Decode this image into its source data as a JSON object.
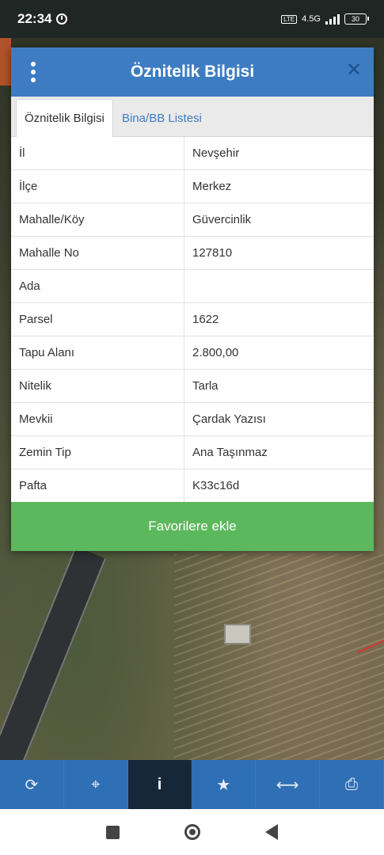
{
  "status": {
    "time": "22:34",
    "network": "4.5G",
    "volte": "LTE",
    "battery": "30"
  },
  "dialog": {
    "title": "Öznitelik Bilgisi",
    "tabs": [
      {
        "label": "Öznitelik Bilgisi",
        "active": true
      },
      {
        "label": "Bina/BB Listesi",
        "active": false
      }
    ],
    "rows": [
      {
        "key": "İl",
        "value": "Nevşehir"
      },
      {
        "key": "İlçe",
        "value": "Merkez"
      },
      {
        "key": "Mahalle/Köy",
        "value": "Güvercinlik"
      },
      {
        "key": "Mahalle No",
        "value": "127810"
      },
      {
        "key": "Ada",
        "value": ""
      },
      {
        "key": "Parsel",
        "value": "1622"
      },
      {
        "key": "Tapu Alanı",
        "value": "2.800,00"
      },
      {
        "key": "Nitelik",
        "value": "Tarla"
      },
      {
        "key": "Mevkii",
        "value": "Çardak Yazısı"
      },
      {
        "key": "Zemin Tip",
        "value": "Ana Taşınmaz"
      },
      {
        "key": "Pafta",
        "value": "K33c16d"
      }
    ],
    "favorite_button": "Favorilere ekle"
  },
  "toolbar": {
    "items": [
      {
        "icon": "refresh-icon",
        "glyph": "⟳"
      },
      {
        "icon": "locate-icon",
        "glyph": "⌖"
      },
      {
        "icon": "info-icon",
        "glyph": "i"
      },
      {
        "icon": "star-icon",
        "glyph": "★"
      },
      {
        "icon": "measure-icon",
        "glyph": "⟷"
      },
      {
        "icon": "print-icon",
        "glyph": "⎙"
      }
    ],
    "active_index": 2
  },
  "colors": {
    "header": "#3d7cc3",
    "favorite": "#5cb85c",
    "toolbar": "#2f6fb5",
    "toolbar_active": "#17273a"
  }
}
